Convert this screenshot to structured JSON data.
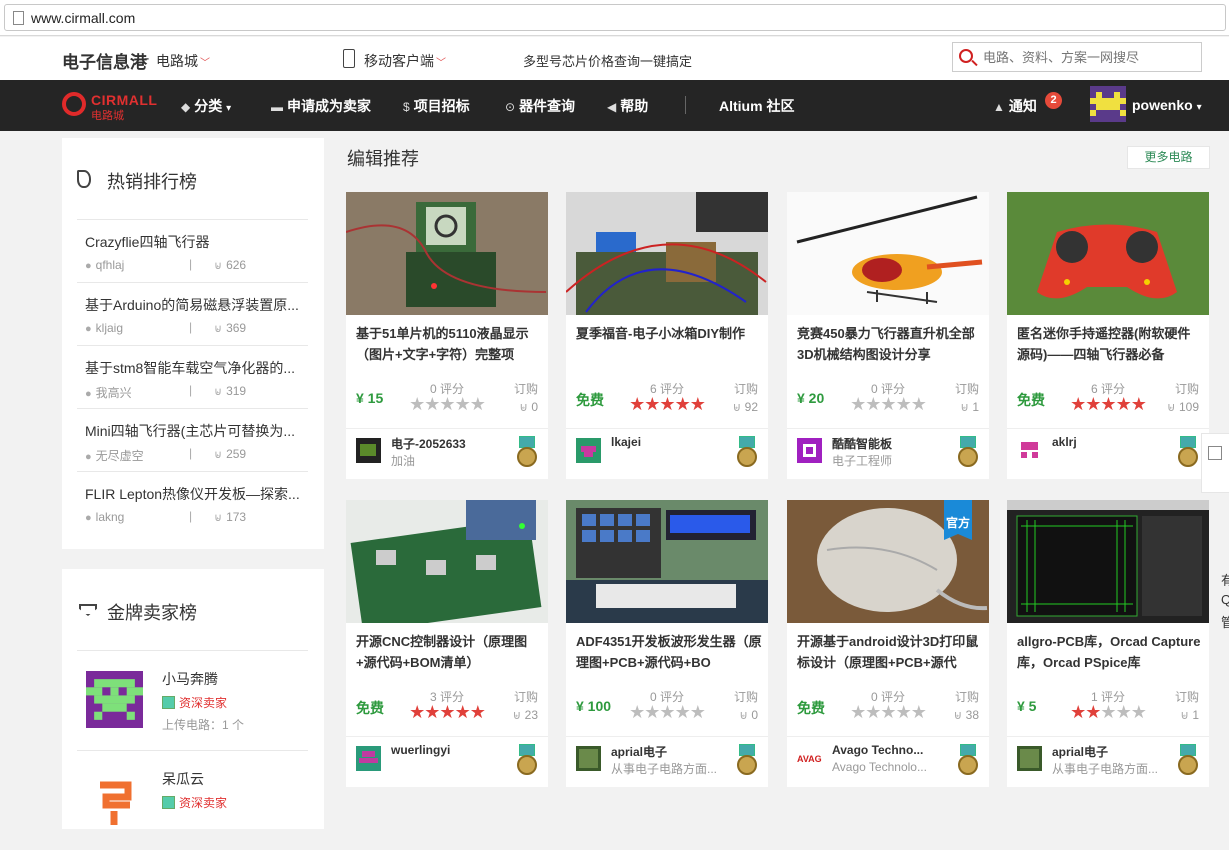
{
  "browser": {
    "url": "www.cirmall.com"
  },
  "topbar": {
    "site_title": "电子信息港",
    "site_sep": "-",
    "site_sub": "电路城",
    "mobile": "移动客户端",
    "promo": "多型号芯片价格查询一键搞定",
    "search_placeholder": "电路、资料、方案一网搜尽"
  },
  "nav": {
    "logo_en": "CIRMALL",
    "logo_cn": "电路城",
    "items": [
      {
        "icon": "tags-icon",
        "label": "分类"
      },
      {
        "icon": "card-icon",
        "label": "申请成为卖家"
      },
      {
        "icon": "dollar-icon",
        "label": "项目招标"
      },
      {
        "icon": "target-icon",
        "label": "器件查询"
      },
      {
        "icon": "megaphone-icon",
        "label": "帮助"
      }
    ],
    "community": "Altium 社区",
    "notify": "通知",
    "notify_count": "2",
    "username": "powenko"
  },
  "hot": {
    "title": "热销排行榜",
    "items": [
      {
        "name": "Crazyflie四轴飞行器",
        "user": "qfhlaj",
        "count": "626"
      },
      {
        "name": "基于Arduino的简易磁悬浮装置原...",
        "user": "kljaig",
        "count": "369"
      },
      {
        "name": "基于stm8智能车载空气净化器的...",
        "user": "我高兴",
        "count": "319"
      },
      {
        "name": "Mini四轴飞行器(主芯片可替换为...",
        "user": "无尽虚空",
        "count": "259"
      },
      {
        "name": "FLIR Lepton热像仪开发板—探索...",
        "user": "lakng",
        "count": "173"
      }
    ]
  },
  "gold": {
    "title": "金牌卖家榜",
    "sellers": [
      {
        "name": "小马奔腾",
        "badge": "资深卖家",
        "uploads": "上传电路：1 个"
      },
      {
        "name": "呆瓜云",
        "badge": "资深卖家"
      }
    ]
  },
  "main": {
    "title": "编辑推荐",
    "more": "更多电路",
    "rating_suffix": "评分",
    "orders_label": "订购",
    "official": "官方",
    "cards": [
      {
        "title": "基于51单片机的5110液晶显示（图片+文字+字符）完整项",
        "price": "¥ 15",
        "rating": "0",
        "stars": 0,
        "orders": "0",
        "author": "电子-2052633",
        "author_sub": "加油"
      },
      {
        "title": "夏季福音-电子小冰箱DIY制作",
        "price": "免费",
        "rating": "6",
        "stars": 5,
        "orders": "92",
        "author": "lkajei",
        "author_sub": ""
      },
      {
        "title": "竞赛450暴力飞行器直升机全部3D机械结构图设计分享",
        "price": "¥ 20",
        "rating": "0",
        "stars": 0,
        "orders": "1",
        "author": "酷酷智能板",
        "author_sub": "电子工程师"
      },
      {
        "title": "匿名迷你手持遥控器(附软硬件源码)——四轴飞行器必备",
        "price": "免费",
        "rating": "6",
        "stars": 5,
        "orders": "109",
        "author": "aklrj",
        "author_sub": ""
      },
      {
        "title": "开源CNC控制器设计（原理图+源代码+BOM清单）",
        "price": "免费",
        "rating": "3",
        "stars": 5,
        "orders": "23",
        "author": "wuerlingyi",
        "author_sub": ""
      },
      {
        "title": "ADF4351开发板波形发生器（原理图+PCB+源代码+BO",
        "price": "¥ 100",
        "rating": "0",
        "stars": 0,
        "orders": "0",
        "author": "aprial电子",
        "author_sub": "从事电子电路方面..."
      },
      {
        "title": "开源基于android设计3D打印鼠标设计（原理图+PCB+源代",
        "price": "免费",
        "rating": "0",
        "stars": 0,
        "orders": "38",
        "author": "Avago Techno...",
        "author_sub": "Avago Technolo..."
      },
      {
        "title": "allgro-PCB库，Orcad Capture库，Orcad PSpice库",
        "price": "¥ 5",
        "rating": "1",
        "stars": 2,
        "orders": "1",
        "author": "aprial电子",
        "author_sub": "从事电子电路方面..."
      }
    ]
  },
  "edge": {
    "chars": [
      "有",
      "Q",
      "管"
    ]
  }
}
